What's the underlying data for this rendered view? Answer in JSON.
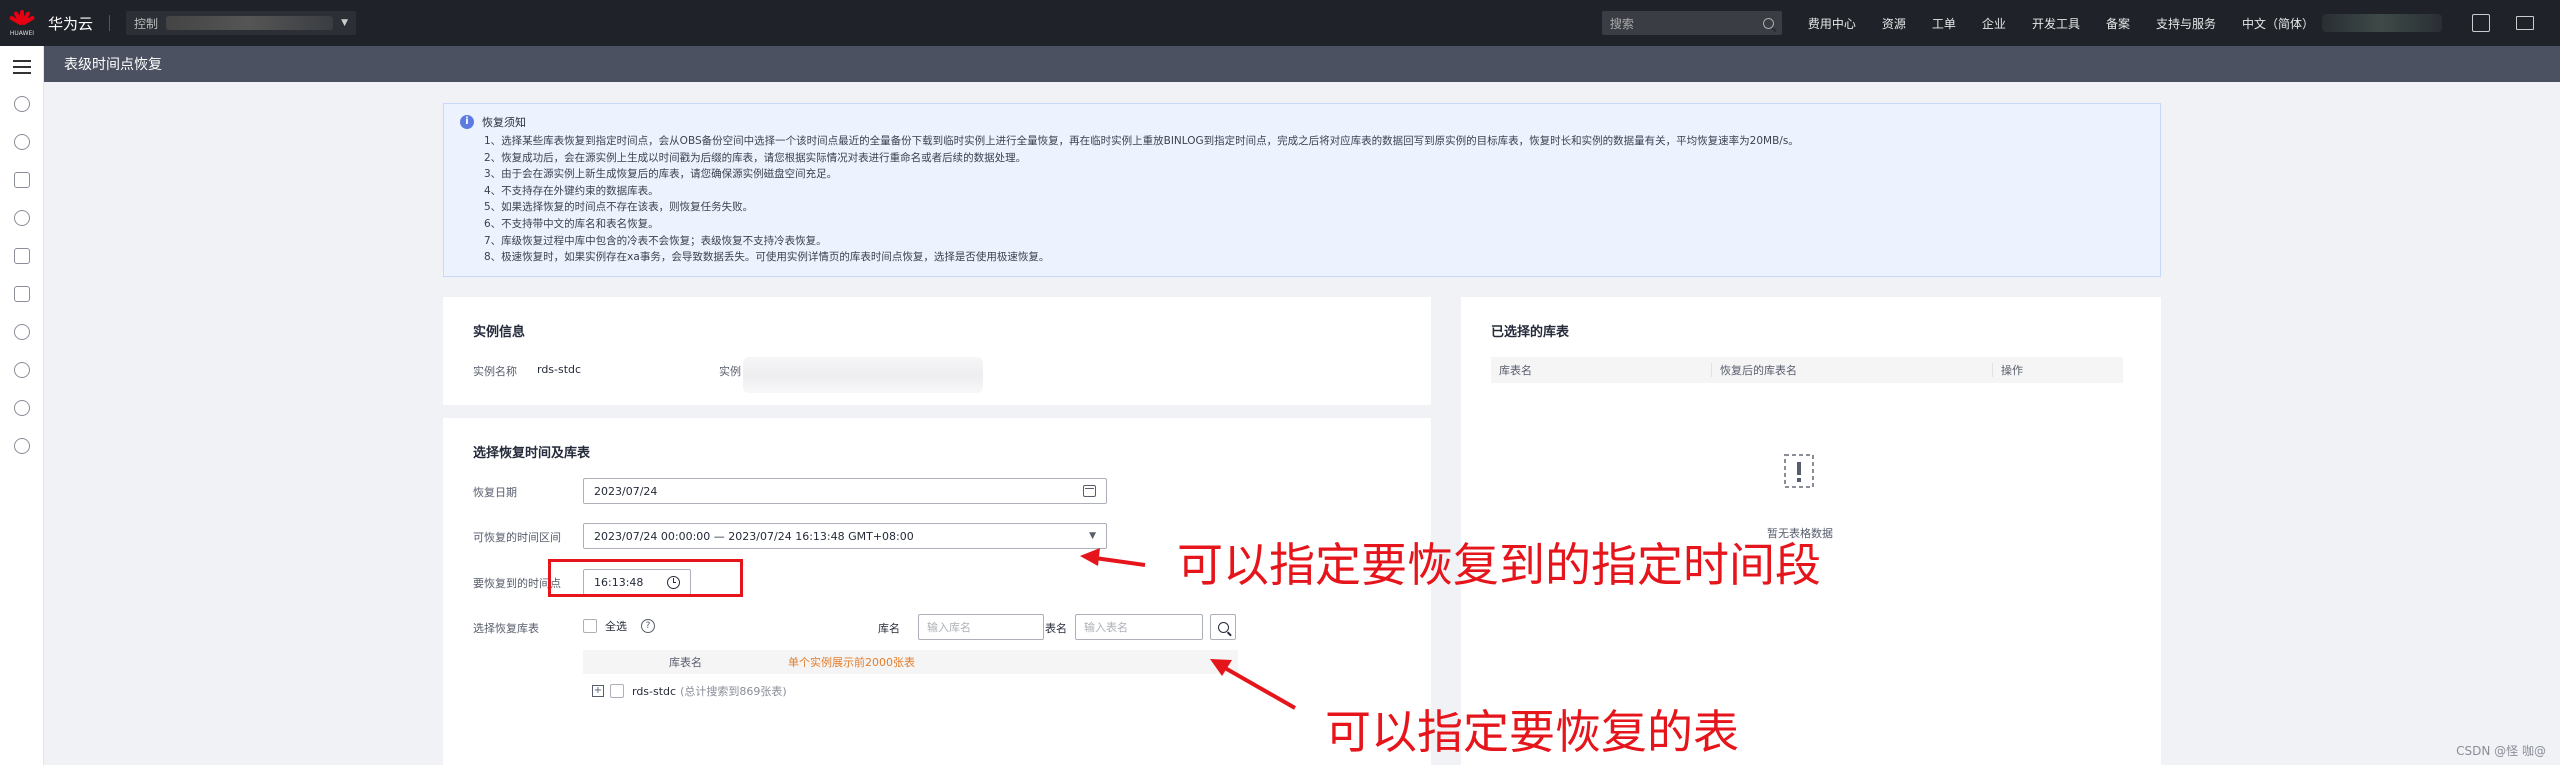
{
  "topbar": {
    "logo_text": "HUAWEI",
    "brand": "华为云",
    "console_label": "控制",
    "search_placeholder": "搜索",
    "links": [
      "费用中心",
      "资源",
      "工单",
      "企业",
      "开发工具",
      "备案",
      "支持与服务",
      "中文（简体）"
    ]
  },
  "page": {
    "title": "表级时间点恢复"
  },
  "notice": {
    "title": "恢复须知",
    "items": [
      "1、选择某些库表恢复到指定时间点，会从OBS备份空间中选择一个该时间点最近的全量备份下载到临时实例上进行全量恢复，再在临时实例上重放BINLOG到指定时间点，完成之后将对应库表的数据回写到原实例的目标库表，恢复时长和实例的数据量有关，平均恢复速率为20MB/s。",
      "2、恢复成功后，会在源实例上生成以时间戳为后缀的库表，请您根据实际情况对表进行重命名或者后续的数据处理。",
      "3、由于会在源实例上新生成恢复后的库表，请您确保源实例磁盘空间充足。",
      "4、不支持存在外键约束的数据库表。",
      "5、如果选择恢复的时间点不存在该表，则恢复任务失败。",
      "6、不支持带中文的库名和表名恢复。",
      "7、库级恢复过程中库中包含的冷表不会恢复；表级恢复不支持冷表恢复。",
      "8、极速恢复时，如果实例存在xa事务，会导致数据丢失。可使用实例详情页的库表时间点恢复，选择是否使用极速恢复。"
    ]
  },
  "instance_info": {
    "title": "实例信息",
    "name_label": "实例名称",
    "name_value": "rds-stdc",
    "id_label": "实例"
  },
  "restore": {
    "title": "选择恢复时间及库表",
    "date_label": "恢复日期",
    "date_value": "2023/07/24",
    "range_label": "可恢复的时间区间",
    "range_value": "2023/07/24 00:00:00 — 2023/07/24 16:13:48 GMT+08:00",
    "time_label": "要恢复到的时间点",
    "time_value": "16:13:48",
    "tables_label": "选择恢复库表",
    "select_all": "全选",
    "db_label": "库名",
    "db_placeholder": "输入库名",
    "table_label": "表名",
    "table_placeholder": "输入表名",
    "col_name": "库表名",
    "col_hint": "单个实例展示前2000张表",
    "tree_item": "rds-stdc",
    "tree_item_hint": "(总计搜索到869张表)"
  },
  "selected": {
    "title": "已选择的库表",
    "columns": [
      "库表名",
      "恢复后的库表名",
      "操作"
    ],
    "empty_text": "暂无表格数据"
  },
  "annotations": {
    "text1": "可以指定要恢复到的指定时间段",
    "text2": "可以指定要恢复的表"
  },
  "watermark": "CSDN @怪 咖@",
  "colors": {
    "accent_red": "#e5151b",
    "brand_red": "#e60012",
    "topbar": "#1f2329",
    "titlebar": "#4b5160",
    "warn_orange": "#e37d29"
  }
}
